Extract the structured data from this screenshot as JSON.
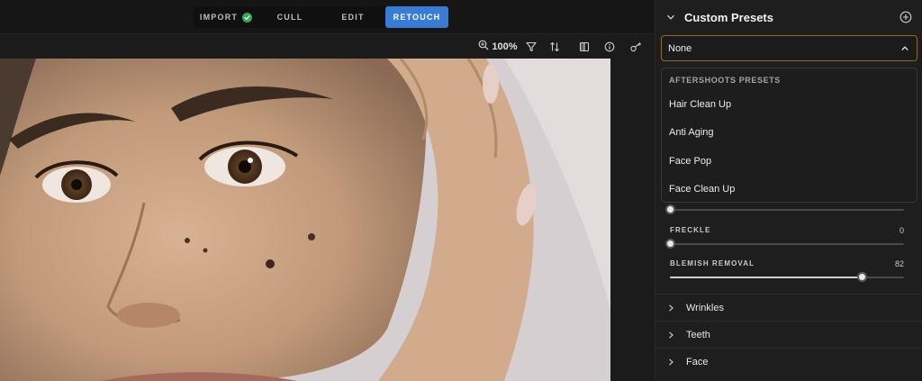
{
  "header": {
    "tabs": [
      {
        "label": "IMPORT",
        "completed": true
      },
      {
        "label": "CULL"
      },
      {
        "label": "EDIT"
      },
      {
        "label": "RETOUCH",
        "active": true
      }
    ]
  },
  "toolbar": {
    "zoom_label": "100%",
    "icons": [
      "zoom-icon",
      "filter-icon",
      "sort-icon",
      "compare-icon",
      "info-icon",
      "key-icon"
    ]
  },
  "panel": {
    "title": "Custom Presets",
    "preset_select": {
      "value": "None"
    },
    "dropdown": {
      "group_label": "AFTERSHOOTS PRESETS",
      "items": [
        "Hair Clean Up",
        "Anti Aging",
        "Face Pop",
        "Face Clean Up"
      ]
    },
    "sliders": [
      {
        "label": "",
        "value": "",
        "fraction": 0.0
      },
      {
        "label": "FRECKLE",
        "value": "0",
        "fraction": 0.0
      },
      {
        "label": "BLEMISH REMOVAL",
        "value": "82",
        "fraction": 0.82
      }
    ],
    "sections": [
      "Wrinkles",
      "Teeth",
      "Face"
    ]
  },
  "colors": {
    "accent": "#3a7bd5",
    "select_border": "#8a6a2a",
    "success": "#34a853",
    "panel_bg": "#1e1e1f"
  }
}
